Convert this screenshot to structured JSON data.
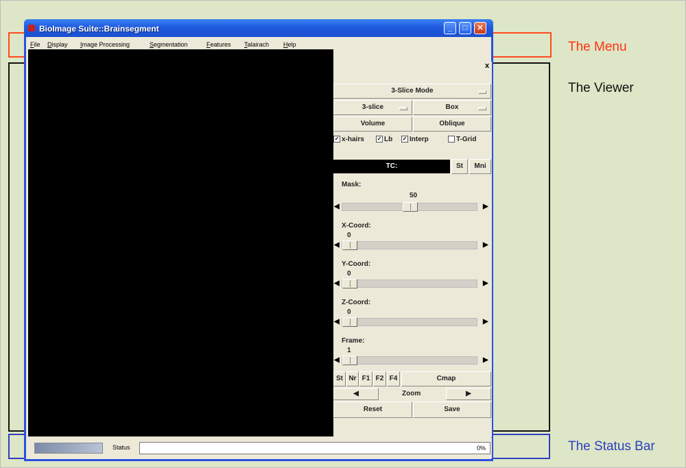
{
  "window": {
    "title": "BioImage Suite::Brainsegment"
  },
  "menu": [
    {
      "label": "File",
      "accel": "F",
      "rest": "ile"
    },
    {
      "label": "Display",
      "accel": "D",
      "rest": "isplay"
    },
    {
      "label": "Image Processing",
      "accel": "I",
      "rest": "mage Processing"
    },
    {
      "label": "Segmentation",
      "accel": "S",
      "rest": "egmentation"
    },
    {
      "label": "Features",
      "accel": "F",
      "rest": "eatures"
    },
    {
      "label": "Talairach",
      "accel": "T",
      "rest": "alairach"
    },
    {
      "label": "Help",
      "accel": "H",
      "rest": "elp"
    }
  ],
  "annotations": {
    "menu": "The Menu",
    "viewer": "The Viewer",
    "status": "The Status Bar"
  },
  "panel": {
    "close": "x",
    "mode": "3-Slice Mode",
    "view": "3-slice",
    "box": "Box",
    "volume": "Volume",
    "oblique": "Oblique",
    "checks": [
      {
        "label": "x-hairs",
        "checked": true
      },
      {
        "label": "Lb",
        "checked": true
      },
      {
        "label": "Interp",
        "checked": true
      },
      {
        "label": "T-Grid",
        "checked": false
      }
    ],
    "tc": "TC:",
    "st": "St",
    "mni": "Mni",
    "sliders": [
      {
        "label": "Mask:",
        "value": "50"
      },
      {
        "label": "X-Coord:",
        "value": "0"
      },
      {
        "label": "Y-Coord:",
        "value": "0"
      },
      {
        "label": "Z-Coord:",
        "value": "0"
      },
      {
        "label": "Frame:",
        "value": "1"
      }
    ],
    "bottom_buttons": [
      "St",
      "Nr",
      "F1",
      "F2",
      "F4"
    ],
    "cmap": "Cmap",
    "zoom": "Zoom",
    "reset": "Reset",
    "save": "Save"
  },
  "status": {
    "label": "Status",
    "percent": "0%"
  }
}
